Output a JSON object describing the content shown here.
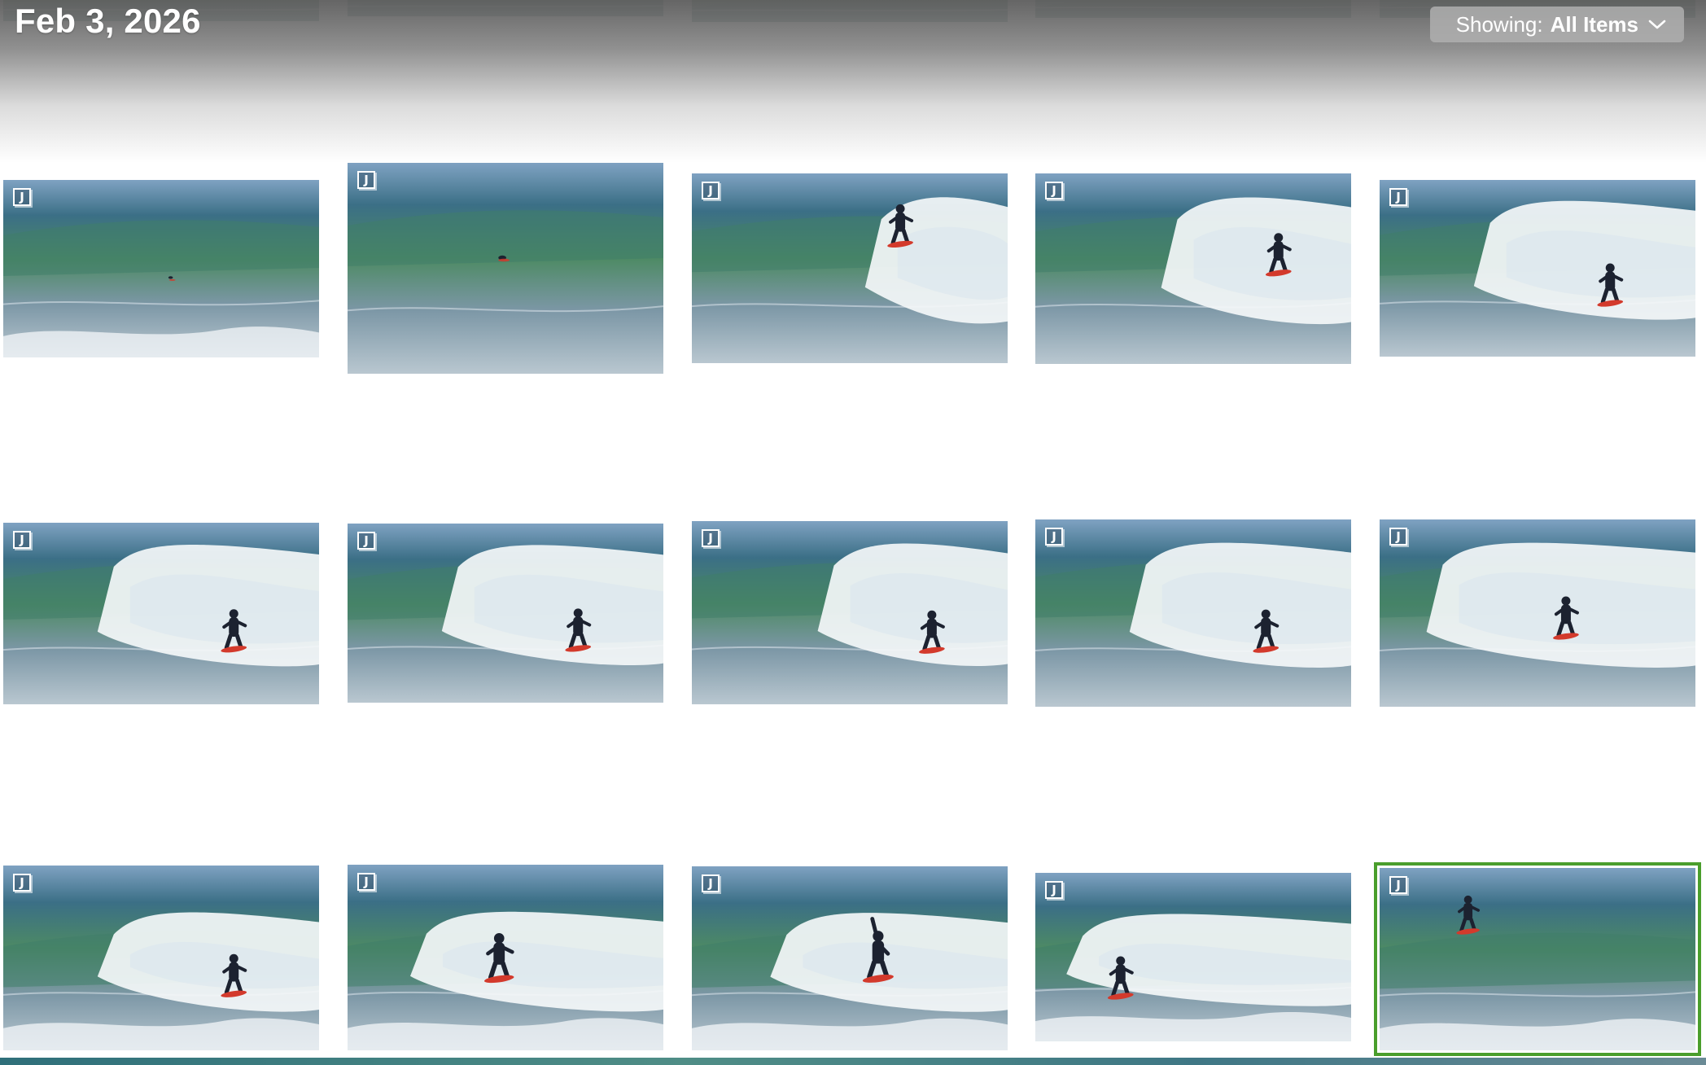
{
  "header": {
    "date": "Feb 3, 2026",
    "filter": {
      "prefix": "Showing:",
      "value": "All Items",
      "icon": "chevron-down-icon"
    }
  },
  "badge_label": "J",
  "colors": {
    "selection": "#4a9e2c",
    "sky": "#7fa2c2",
    "sea_deep": "#3b6f86",
    "wave_green": "#4d8a64",
    "foam": "#f4f7f9",
    "board": "#d33a2c",
    "wetsuit": "#1c2230"
  },
  "photos": [
    {
      "id": "r0c0",
      "row": 0,
      "scene": "calm"
    },
    {
      "id": "r0c1",
      "row": 0,
      "scene": "calm"
    },
    {
      "id": "r0c2",
      "row": 0,
      "scene": "calm"
    },
    {
      "id": "r0c3",
      "row": 0,
      "scene": "calm"
    },
    {
      "id": "r0c4",
      "row": 0,
      "scene": "calm"
    },
    {
      "id": "r1c0",
      "row": 1,
      "scene": "paddle",
      "badge": true
    },
    {
      "id": "r1c1",
      "row": 1,
      "scene": "duck",
      "badge": true
    },
    {
      "id": "r1c2",
      "row": 1,
      "scene": "drop",
      "badge": true
    },
    {
      "id": "r1c3",
      "row": 1,
      "scene": "barrel",
      "badge": true
    },
    {
      "id": "r1c4",
      "row": 1,
      "scene": "ride",
      "badge": true
    },
    {
      "id": "r2c0",
      "row": 2,
      "scene": "ride",
      "badge": true
    },
    {
      "id": "r2c1",
      "row": 2,
      "scene": "ride",
      "badge": true
    },
    {
      "id": "r2c2",
      "row": 2,
      "scene": "turn",
      "badge": true
    },
    {
      "id": "r2c3",
      "row": 2,
      "scene": "ride",
      "badge": true
    },
    {
      "id": "r2c4",
      "row": 2,
      "scene": "whitewater",
      "badge": true
    },
    {
      "id": "r3c0",
      "row": 3,
      "scene": "ride",
      "badge": true
    },
    {
      "id": "r3c1",
      "row": 3,
      "scene": "air",
      "badge": true
    },
    {
      "id": "r3c2",
      "row": 3,
      "scene": "arm",
      "badge": true
    },
    {
      "id": "r3c3",
      "row": 3,
      "scene": "wipe",
      "badge": true
    },
    {
      "id": "r3c4",
      "row": 3,
      "scene": "green",
      "badge": true,
      "selected": true
    }
  ]
}
